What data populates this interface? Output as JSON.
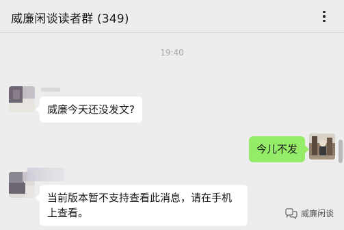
{
  "header": {
    "title": "威廉闲谈读者群 (349)",
    "more_icon": "more-dots-icon"
  },
  "chat": {
    "timestamp": "19:40",
    "messages": [
      {
        "direction": "in",
        "text": "威廉今天还没发文?"
      },
      {
        "direction": "out",
        "text": "今儿不发"
      },
      {
        "direction": "in",
        "text": "当前版本暂不支持查看此消息，请在手机上查看。"
      }
    ]
  },
  "watermark": {
    "text": "威廉闲谈",
    "icon": "wechat-channel-icon"
  },
  "colors": {
    "background": "#ededed",
    "incoming_bubble": "#ffffff",
    "outgoing_bubble": "#95ec69",
    "timestamp": "#a8a8a8"
  }
}
